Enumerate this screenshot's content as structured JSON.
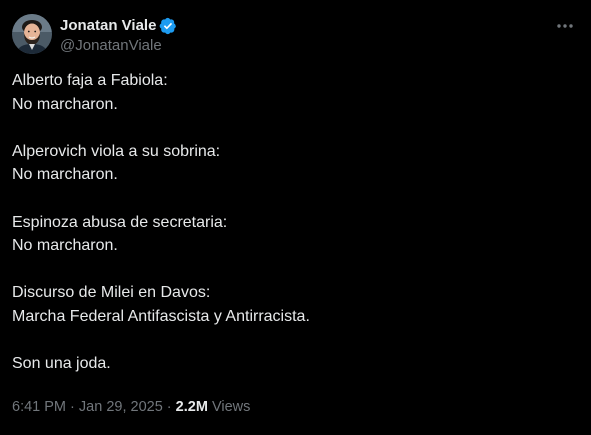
{
  "author": {
    "display_name": "Jonatan Viale",
    "handle": "@JonatanViale",
    "verified": true,
    "verified_color": "#1d9bf0",
    "avatar_icon": "profile-photo-avatar",
    "more_icon": "more-options-icon"
  },
  "tweet": {
    "lines": [
      "Alberto faja a Fabiola:",
      "No marcharon.",
      "",
      "Alperovich viola a su sobrina:",
      "No marcharon.",
      "",
      "Espinoza abusa de secretaria:",
      "No marcharon.",
      "",
      "Discurso de Milei en Davos:",
      "Marcha Federal Antifascista y Antirracista.",
      "",
      "Son una joda."
    ]
  },
  "meta": {
    "time": "6:41 PM",
    "separator": "·",
    "date": "Jan 29, 2025",
    "views_count": "2.2M",
    "views_label": "Views"
  },
  "colors": {
    "background": "#000000",
    "text_primary": "#e7e9ea",
    "text_secondary": "#71767b",
    "accent": "#1d9bf0"
  }
}
